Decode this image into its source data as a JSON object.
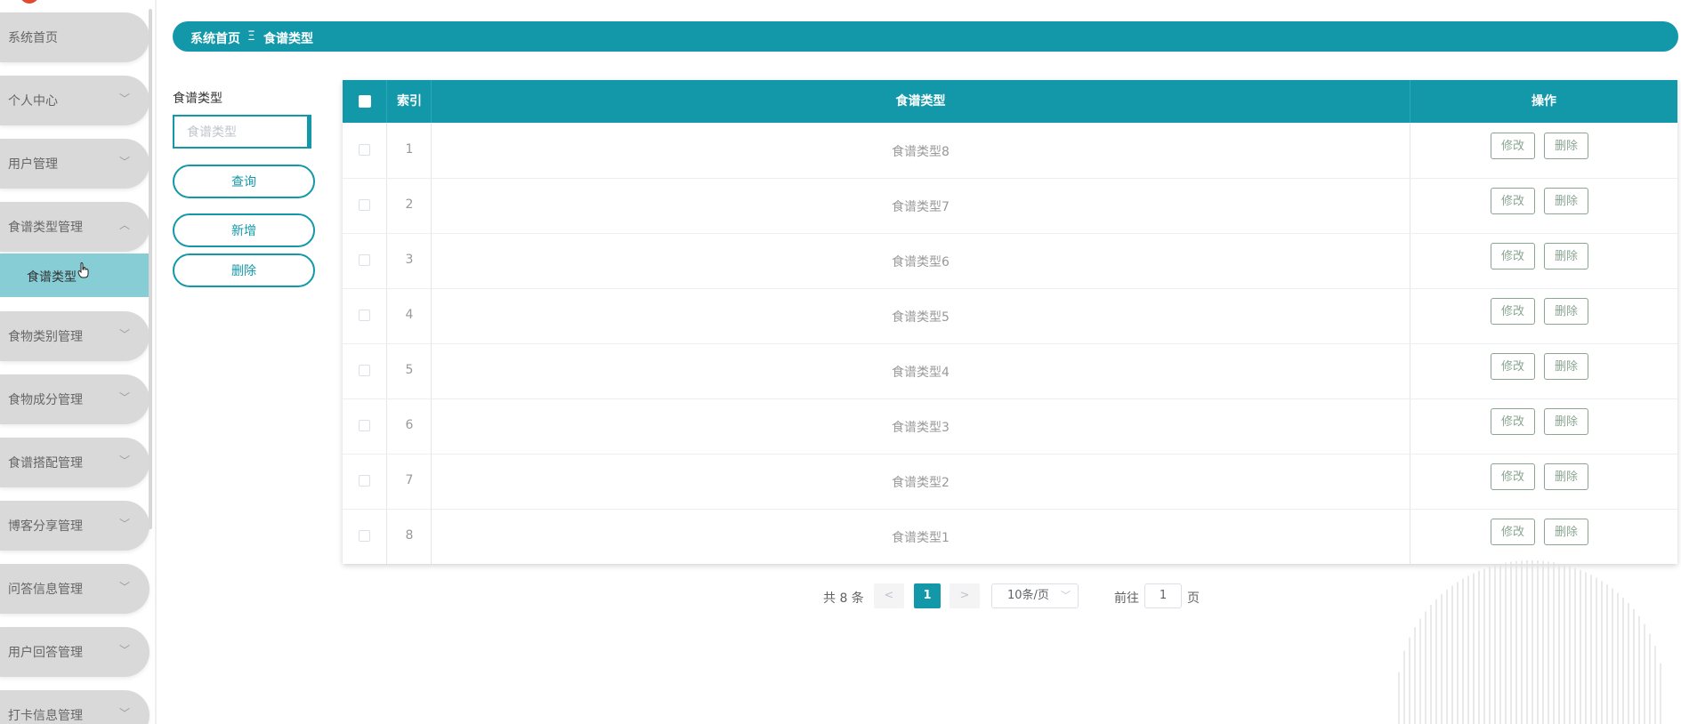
{
  "sidebar": {
    "items": [
      {
        "label": "系统首页",
        "chevron": ""
      },
      {
        "label": "个人中心",
        "chevron": "﹀"
      },
      {
        "label": "用户管理",
        "chevron": "﹀"
      },
      {
        "label": "食谱类型管理",
        "chevron": "︿"
      },
      {
        "label": "食物类别管理",
        "chevron": "﹀"
      },
      {
        "label": "食物成分管理",
        "chevron": "﹀"
      },
      {
        "label": "食谱搭配管理",
        "chevron": "﹀"
      },
      {
        "label": "博客分享管理",
        "chevron": "﹀"
      },
      {
        "label": "问答信息管理",
        "chevron": "﹀"
      },
      {
        "label": "用户回答管理",
        "chevron": "﹀"
      },
      {
        "label": "打卡信息管理",
        "chevron": "﹀"
      }
    ],
    "active_sub": "食谱类型"
  },
  "breadcrumb": {
    "home": "系统首页",
    "sep": "Ξ",
    "current": "食谱类型"
  },
  "search": {
    "label": "食谱类型",
    "placeholder": "食谱类型",
    "query_btn": "查询",
    "add_btn": "新增",
    "delete_btn": "删除"
  },
  "table": {
    "headers": {
      "index": "索引",
      "type": "食谱类型",
      "ops": "操作"
    },
    "edit_label": "修改",
    "delete_label": "删除",
    "rows": [
      {
        "index": "1",
        "type": "食谱类型8"
      },
      {
        "index": "2",
        "type": "食谱类型7"
      },
      {
        "index": "3",
        "type": "食谱类型6"
      },
      {
        "index": "4",
        "type": "食谱类型5"
      },
      {
        "index": "5",
        "type": "食谱类型4"
      },
      {
        "index": "6",
        "type": "食谱类型3"
      },
      {
        "index": "7",
        "type": "食谱类型2"
      },
      {
        "index": "8",
        "type": "食谱类型1"
      }
    ]
  },
  "pagination": {
    "total": "共 8 条",
    "prev": "<",
    "current": "1",
    "next": ">",
    "page_size": "10条/页",
    "goto_label": "前往",
    "goto_value": "1",
    "page_suffix": "页"
  },
  "colors": {
    "accent": "#1298a9",
    "submenu_active": "#87cdd6",
    "menu_bg": "#d9d9d9",
    "op_btn": "#8aa591"
  }
}
